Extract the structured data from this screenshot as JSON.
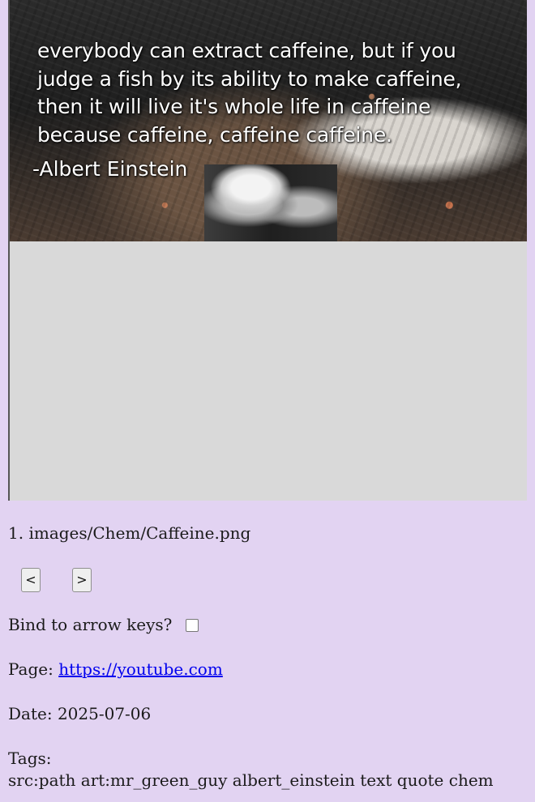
{
  "image": {
    "quote_lines": "everybody can extract caffeine, but if you\njudge a fish by its ability to make caffeine,\nthen it will live it's whole life in caffeine\nbecause caffeine, caffeine caffeine.",
    "author": "-Albert Einstein"
  },
  "file": {
    "index": "1.",
    "path": "images/Chem/Caffeine.png"
  },
  "navigation": {
    "prev_label": "<",
    "next_label": ">"
  },
  "options": {
    "bind_label": "Bind to arrow keys?",
    "bind_checked": false
  },
  "page": {
    "label": "Page:",
    "url": "https://youtube.com"
  },
  "date": {
    "label": "Date:",
    "value": "2025-07-06"
  },
  "tags": {
    "label": "Tags:",
    "value": "src:path art:mr_green_guy albert_einstein text quote chem"
  }
}
